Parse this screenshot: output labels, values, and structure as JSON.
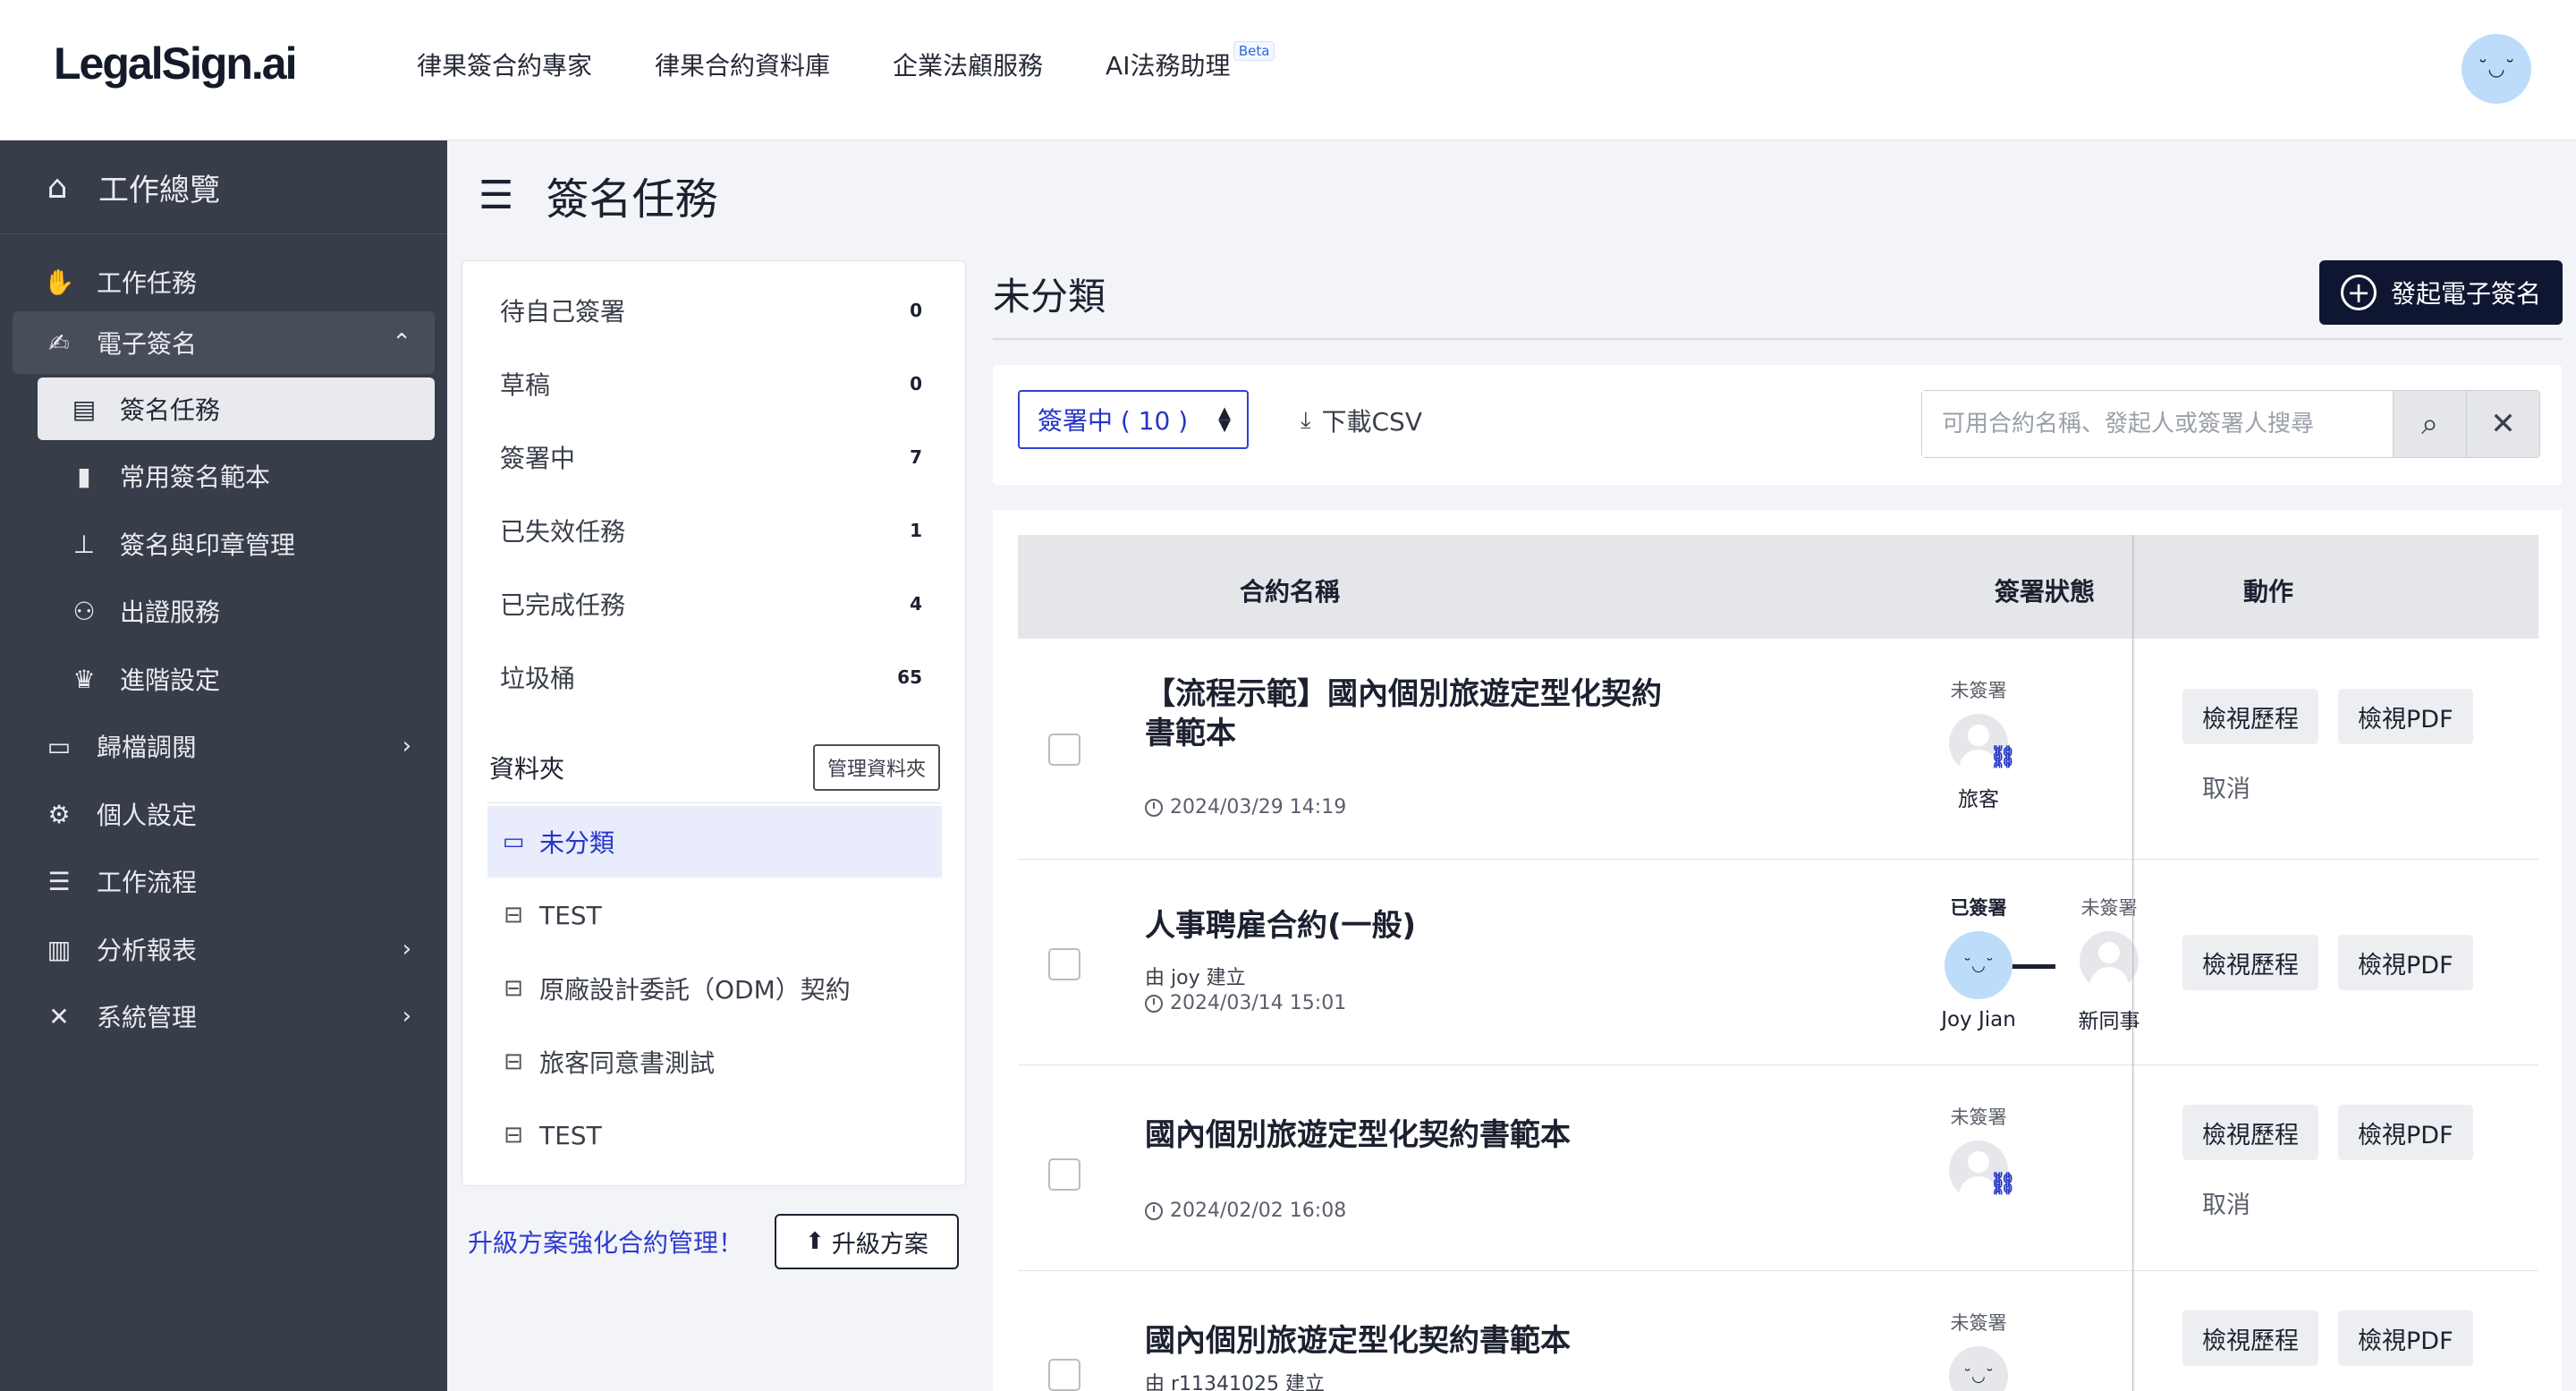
{
  "topnav": {
    "logo": "LegalSign.ai",
    "links": [
      "律果簽合約專家",
      "律果合約資料庫",
      "企業法顧服務",
      "AI法務助理"
    ],
    "beta": "Beta",
    "avatar_face": "˘◡˘"
  },
  "sidebar": {
    "home": "工作總覽",
    "items": [
      {
        "label": "工作任務",
        "icon": "handshake-icon"
      },
      {
        "label": "電子簽名",
        "icon": "signature-icon"
      },
      {
        "label": "歸檔調閱",
        "icon": "archive-icon"
      },
      {
        "label": "個人設定",
        "icon": "user-gear-icon"
      },
      {
        "label": "工作流程",
        "icon": "checklist-icon"
      },
      {
        "label": "分析報表",
        "icon": "chart-icon"
      },
      {
        "label": "系統管理",
        "icon": "tools-icon"
      }
    ],
    "sub_items": [
      {
        "label": "簽名任務",
        "icon": "file-signature-icon"
      },
      {
        "label": "常用簽名範本",
        "icon": "clipboard-icon"
      },
      {
        "label": "簽名與印章管理",
        "icon": "stamp-icon"
      },
      {
        "label": "出證服務",
        "icon": "award-icon"
      },
      {
        "label": "進階設定",
        "icon": "crown-icon"
      }
    ]
  },
  "page": {
    "title": "簽名任務"
  },
  "folders_panel": {
    "statuses": [
      {
        "label": "待自己簽署",
        "count": "0"
      },
      {
        "label": "草稿",
        "count": "0"
      },
      {
        "label": "簽署中",
        "count": "7"
      },
      {
        "label": "已失效任務",
        "count": "1"
      },
      {
        "label": "已完成任務",
        "count": "4"
      },
      {
        "label": "垃圾桶",
        "count": "65"
      }
    ],
    "folder_heading": "資料夾",
    "manage_button": "管理資料夾",
    "folders": [
      "未分類",
      "TEST",
      "原廠設計委託（ODM）契約",
      "旅客同意書測試",
      "TEST"
    ],
    "upgrade_text": "升級方案強化合約管理！",
    "upgrade_button": "升級方案"
  },
  "main": {
    "section_title": "未分類",
    "start_button": "發起電子簽名",
    "status_select": "簽署中 ( 10 )",
    "download": "下載CSV",
    "search_placeholder": "可用合約名稱、發起人或簽署人搜尋",
    "columns": {
      "name": "合約名稱",
      "status": "簽署狀態",
      "action": "動作"
    },
    "rows": [
      {
        "title": "【流程示範】國內個別旅遊定型化契約書範本",
        "creator": "",
        "date": "2024/03/29 14:19",
        "signers": [
          {
            "status": "未簽署",
            "name": "旅客"
          }
        ],
        "actions": [
          "檢視歷程",
          "檢視PDF"
        ],
        "cancel": "取消"
      },
      {
        "title": "人事聘雇合約(一般)",
        "creator": "由 joy 建立",
        "date": "2024/03/14 15:01",
        "signers": [
          {
            "status": "已簽署",
            "name": "Joy Jian"
          },
          {
            "status": "未簽署",
            "name": "新同事"
          }
        ],
        "actions": [
          "檢視歷程",
          "檢視PDF"
        ],
        "cancel": ""
      },
      {
        "title": "國內個別旅遊定型化契約書範本",
        "creator": "",
        "date": "2024/02/02 16:08",
        "signers": [
          {
            "status": "未簽署",
            "name": ""
          }
        ],
        "actions": [
          "檢視歷程",
          "檢視PDF"
        ],
        "cancel": "取消"
      },
      {
        "title": "國內個別旅遊定型化契約書範本",
        "creator": "由 r11341025 建立",
        "date": "",
        "signers": [
          {
            "status": "未簽署",
            "name": ""
          }
        ],
        "actions": [
          "檢視歷程",
          "檢視PDF"
        ],
        "cancel": ""
      }
    ]
  }
}
